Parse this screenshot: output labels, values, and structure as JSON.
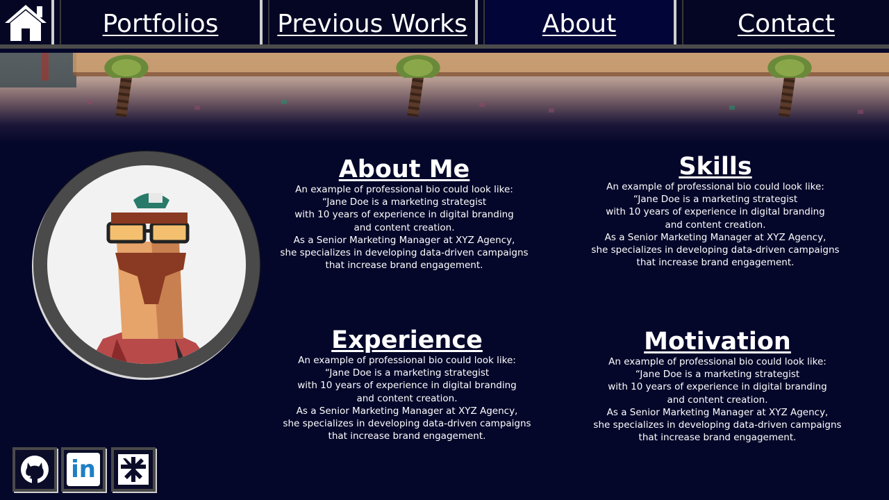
{
  "nav": {
    "home_icon": "home-icon",
    "items": [
      {
        "label": "Portfolios"
      },
      {
        "label": "Previous Works"
      },
      {
        "label": "About",
        "active": true
      },
      {
        "label": "Contact"
      }
    ]
  },
  "sections": {
    "about": {
      "title": "About Me",
      "body": "An example of professional bio could look like:\n“Jane Doe is a marketing strategist\nwith 10 years of experience in digital branding\nand content creation.\nAs a Senior Marketing Manager at XYZ Agency,\nshe specializes in developing data-driven campaigns\nthat increase brand engagement."
    },
    "skills": {
      "title": "Skills",
      "body": "An example of professional bio could look like:\n“Jane Doe is a marketing strategist\nwith 10 years of experience in digital branding\nand content creation.\nAs a Senior Marketing Manager at XYZ Agency,\nshe specializes in developing data-driven campaigns\nthat increase brand engagement."
    },
    "experience": {
      "title": "Experience",
      "body": "An example of professional bio could look like:\n“Jane Doe is a marketing strategist\nwith 10 years of experience in digital branding\nand content creation.\nAs a Senior Marketing Manager at XYZ Agency,\nshe specializes in developing data-driven campaigns\nthat increase brand engagement."
    },
    "motivation": {
      "title": "Motivation",
      "body": "An example of professional bio could look like:\n“Jane Doe is a marketing strategist\nwith 10 years of experience in digital branding\nand content creation.\nAs a Senior Marketing Manager at XYZ Agency,\nshe specializes in developing data-driven campaigns\nthat increase brand engagement."
    }
  },
  "social": {
    "icons": [
      "github-icon",
      "linkedin-icon",
      "linktree-icon"
    ],
    "linkedin_text": "in"
  },
  "colors": {
    "background": "#05072a",
    "nav_background": "#050624",
    "nav_active": "#020537",
    "nav_border": "#cfcfcf",
    "linkedin_blue": "#1d7fc4"
  }
}
